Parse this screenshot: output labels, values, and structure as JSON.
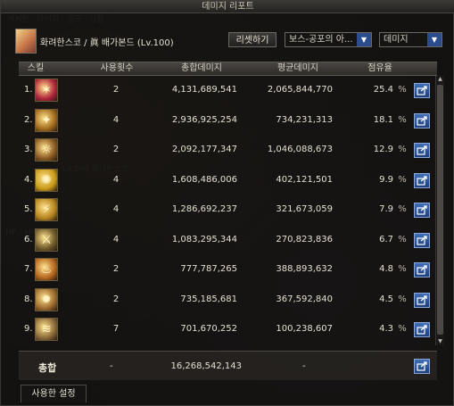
{
  "window": {
    "title": "데미지 리포트"
  },
  "header": {
    "character": "화려한스코 / 眞 배가본드 (Lv.100)",
    "reset_label": "리셋하기",
    "filter_select": "보스-공포의 아...",
    "metric_select": "데미지"
  },
  "table": {
    "columns": [
      "스킬",
      "사용횟수",
      "총합데미지",
      "평균데미지",
      "점유율"
    ],
    "percent_sign": "%",
    "rows": [
      {
        "rank": "1.",
        "uses": "2",
        "total": "4,131,689,541",
        "avg": "2,065,844,770",
        "share": "25.4",
        "icon_color": "#b0243c",
        "icon_glyph": "✶"
      },
      {
        "rank": "2.",
        "uses": "4",
        "total": "2,936,925,254",
        "avg": "734,231,313",
        "share": "18.1",
        "icon_color": "#a26a1c",
        "icon_glyph": "✦"
      },
      {
        "rank": "3.",
        "uses": "2",
        "total": "2,092,177,347",
        "avg": "1,046,088,673",
        "share": "12.9",
        "icon_color": "#8a5a22",
        "icon_glyph": "☼"
      },
      {
        "rank": "4.",
        "uses": "4",
        "total": "1,608,486,006",
        "avg": "402,121,501",
        "share": "9.9",
        "icon_color": "#c79a18",
        "icon_glyph": "✺"
      },
      {
        "rank": "5.",
        "uses": "4",
        "total": "1,286,692,237",
        "avg": "321,673,059",
        "share": "7.9",
        "icon_color": "#b5841d",
        "icon_glyph": "⚡"
      },
      {
        "rank": "6.",
        "uses": "4",
        "total": "1,083,295,344",
        "avg": "270,823,836",
        "share": "6.7",
        "icon_color": "#6e5a2b",
        "icon_glyph": "⚔"
      },
      {
        "rank": "7.",
        "uses": "2",
        "total": "777,787,265",
        "avg": "388,893,632",
        "share": "4.8",
        "icon_color": "#b4661e",
        "icon_glyph": "♨"
      },
      {
        "rank": "8.",
        "uses": "2",
        "total": "735,185,681",
        "avg": "367,592,840",
        "share": "4.5",
        "icon_color": "#9c6b2e",
        "icon_glyph": "✹"
      },
      {
        "rank": "9.",
        "uses": "7",
        "total": "701,670,252",
        "avg": "100,238,607",
        "share": "4.3",
        "icon_color": "#8b6a3a",
        "icon_glyph": "≋"
      }
    ]
  },
  "total": {
    "label": "총합",
    "uses": "-",
    "value": "16,268,542,143",
    "avg": "-"
  },
  "footer": {
    "settings_tab": "사용한 설정"
  }
}
